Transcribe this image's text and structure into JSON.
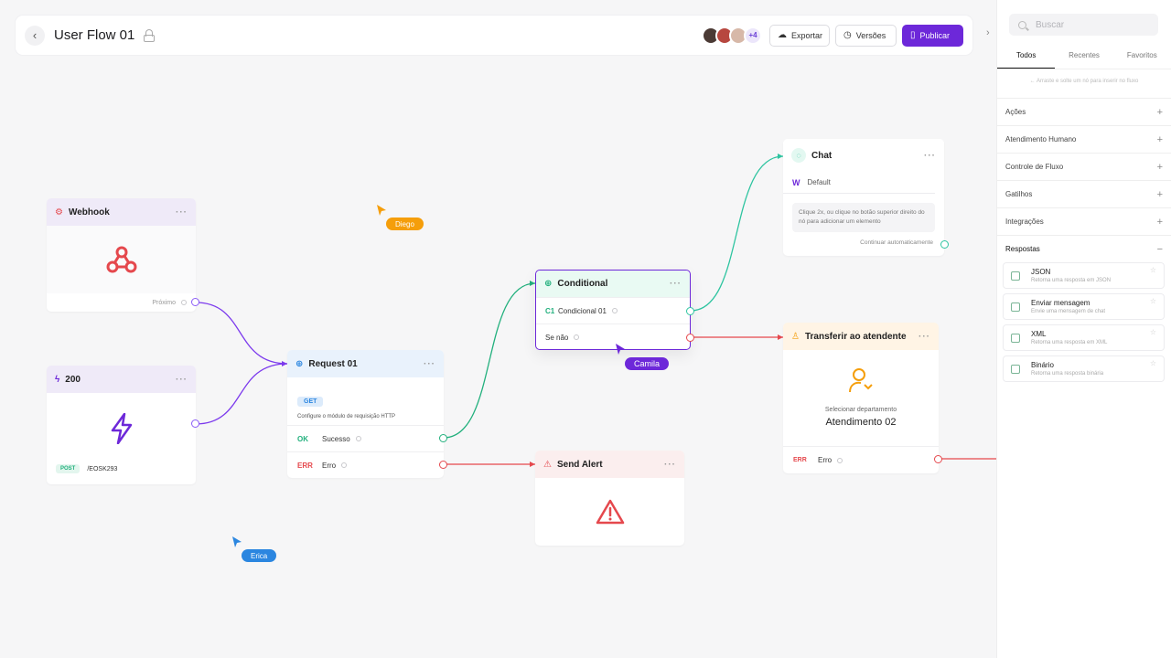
{
  "header": {
    "title": "User Flow 01",
    "avatars_more": "+4",
    "export_label": "Exportar",
    "versions_label": "Versões",
    "publish_label": "Publicar"
  },
  "nodes": {
    "webhook": {
      "title": "Webhook",
      "next_label": "Próximo"
    },
    "trigger200": {
      "title": "200",
      "method": "POST",
      "path": "/EOSK293"
    },
    "request": {
      "title": "Request 01",
      "method": "GET",
      "description": "Configure o módulo de requisição HTTP",
      "ok_tag": "OK",
      "ok_label": "Sucesso",
      "err_tag": "ERR",
      "err_label": "Erro"
    },
    "conditional": {
      "title": "Conditional",
      "c1_tag": "C1",
      "c1_label": "Condicional 01",
      "else_label": "Se não"
    },
    "chat": {
      "title": "Chat",
      "channel": "Default",
      "hint": "Clique 2x, ou clique no botão superior direito do nó para adicionar um elemento",
      "continue_label": "Continuar automaticamente"
    },
    "transfer": {
      "title": "Transferir ao atendente",
      "select_label": "Selecionar departamento",
      "department": "Atendimento 02",
      "err_tag": "ERR",
      "err_label": "Erro"
    },
    "alert": {
      "title": "Send Alert"
    }
  },
  "cursors": [
    {
      "name": "Diego",
      "color": "#f59e0b"
    },
    {
      "name": "Camila",
      "color": "#6d28d9"
    },
    {
      "name": "Erica",
      "color": "#2b86e0"
    }
  ],
  "sidebar": {
    "search_placeholder": "Buscar",
    "tabs": [
      "Todos",
      "Recentes",
      "Favoritos"
    ],
    "drag_hint": "← Arraste e solte um nó para inserir no fluxo",
    "categories": [
      "Ações",
      "Atendimento Humano",
      "Controle de Fluxo",
      "Gatilhos",
      "Integrações"
    ],
    "expanded_category": "Respostas",
    "responses": [
      {
        "title": "JSON",
        "desc": "Retorna uma resposta em JSON"
      },
      {
        "title": "Enviar mensagem",
        "desc": "Envie uma mensagem de chat"
      },
      {
        "title": "XML",
        "desc": "Retorna uma resposta em XML"
      },
      {
        "title": "Binário",
        "desc": "Retorna uma resposta binária"
      }
    ]
  },
  "colors": {
    "accent": "#6d28d9",
    "success": "#22b07d",
    "error": "#e5484d",
    "chat": "#2ec4a0",
    "warning": "#f59e0b"
  }
}
